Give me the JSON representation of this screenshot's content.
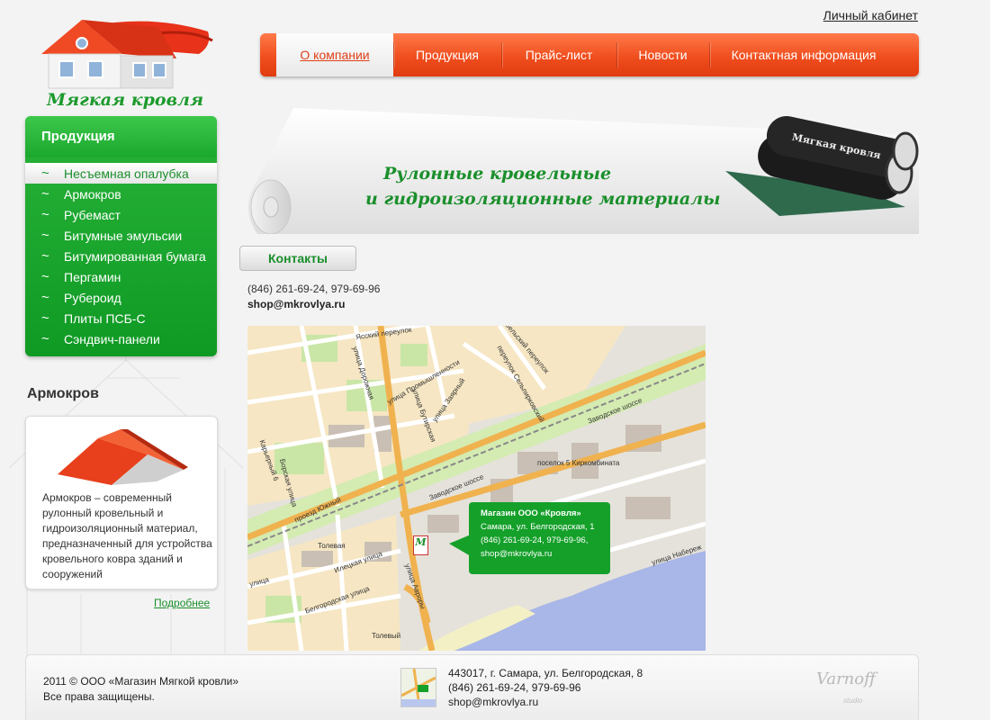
{
  "brand": {
    "name": "Мягкая кровля"
  },
  "header": {
    "account_link": "Личный кабинет"
  },
  "nav": {
    "items": [
      {
        "label": "О компании",
        "active": true
      },
      {
        "label": "Продукция"
      },
      {
        "label": "Прайс-лист"
      },
      {
        "label": "Новости"
      },
      {
        "label": "Контактная информация"
      }
    ]
  },
  "sidebar": {
    "title": "Продукция",
    "bullet": "~",
    "items": [
      {
        "label": "Несъемная опалубка",
        "active": true
      },
      {
        "label": "Армокров"
      },
      {
        "label": "Рубемаст"
      },
      {
        "label": "Битумные эмульсии"
      },
      {
        "label": "Битумированная бумага"
      },
      {
        "label": "Пергамин"
      },
      {
        "label": "Рубероид"
      },
      {
        "label": "Плиты ПСБ-С"
      },
      {
        "label": "Сэндвич-панели"
      }
    ],
    "promo": {
      "heading": "Армокров",
      "text": "Армокров – современный рулонный кровельный и гидроизоляционный материал, предназначенный для устройства кровельного ковра зданий и сооружений",
      "more_link": "Подробнее"
    }
  },
  "banner": {
    "line1": "Рулонные кровельные",
    "line2": "и гидроизоляционные материалы",
    "roll_label": "Мягкая кровля"
  },
  "contacts": {
    "button": "Контакты",
    "phone": "(846) 261-69-24, 979-69-96",
    "email": "shop@mkrovlya.ru"
  },
  "map": {
    "popup_title": "Магазин ООО «Кровля»",
    "popup_address": "Самара, ул. Белгородская, 1",
    "popup_phone": "(846) 261-69-24, 979-69-96,",
    "popup_email": "shop@mkrovlya.ru",
    "marker": "М",
    "labels": {
      "yassky": "Ясский переулок",
      "dorozhnaya": "улица Дорожная",
      "promyshlennosti": "улица Промышленности",
      "zayarny": "улица Заярный",
      "butyrskaya": "улица Бутирская",
      "beltsky": "Бельский переулок",
      "selpirkovsky": "переулок Сельпирковский",
      "zavodskoe1": "Заводское шоссе",
      "zavodskoe2": "Заводское шоссе",
      "poselok": "поселок 5 Киркомбината",
      "karernaya": "Карьерный 6",
      "borskaya": "Борская улица",
      "proezd": "проезд Южный",
      "tolevaya": "Толевая",
      "ilecka": "Илецкая улица",
      "avrora": "улица Авроры",
      "belgorodskaya": "Белгородская улица",
      "naberezhnaya": "улица Набереж",
      "tolevy": "Толевый",
      "yuzhnaya": "улица"
    }
  },
  "footer": {
    "copyright_line1": "2011 © ООО «Магазин Мягкой кровли»",
    "copyright_line2": "Все права защищены.",
    "address": "443017, г. Самара, ул. Белгородская, 8",
    "phone": "(846) 261-69-24, 979-69-96",
    "email": "shop@mkrovlya.ru",
    "studio": "Varnoff",
    "studio_sub": "studio"
  }
}
